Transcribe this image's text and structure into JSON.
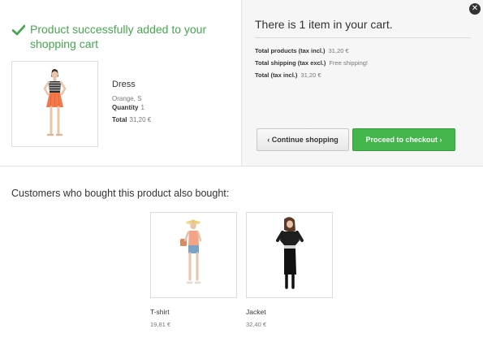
{
  "close_icon": "close-icon",
  "success": {
    "message": "Product successfully added to your shopping cart",
    "icon": "check-icon",
    "color": "#46a74e"
  },
  "product": {
    "name": "Dress",
    "attributes": "Orange, S",
    "quantity_label": "Quantity",
    "quantity": "1",
    "total_label": "Total",
    "total": "31,20 €"
  },
  "cart": {
    "title": "There is 1 item in your cart.",
    "products_label": "Total products (tax incl.)",
    "products_value": "31,20 €",
    "shipping_label": "Total shipping (tax excl.)",
    "shipping_value": "Free shipping!",
    "total_label": "Total (tax incl.)",
    "total_value": "31,20 €",
    "continue_label": "Continue shopping",
    "checkout_label": "Proceed to checkout",
    "checkout_color": "#43b54b"
  },
  "also": {
    "title": "Customers who bought this product also bought:",
    "items": [
      {
        "name": "T-shirt",
        "price": "19,81 €"
      },
      {
        "name": "Jacket",
        "price": "32,40 €"
      }
    ]
  }
}
